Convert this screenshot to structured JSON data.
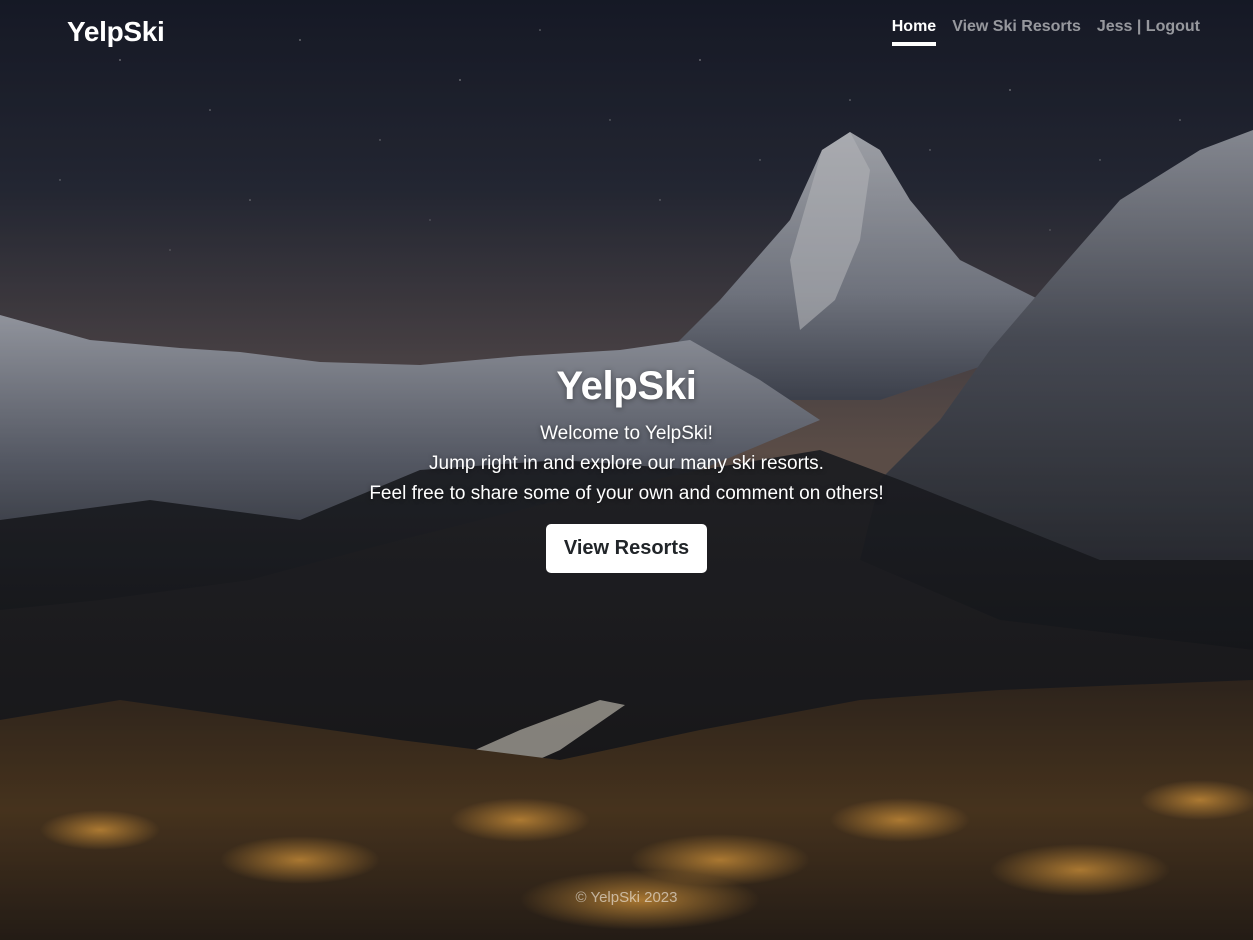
{
  "nav": {
    "brand": "YelpSki",
    "links": [
      {
        "label": "Home",
        "active": true
      },
      {
        "label": "View Ski Resorts",
        "active": false
      },
      {
        "label": "Jess | Logout",
        "active": false
      }
    ]
  },
  "hero": {
    "title": "YelpSki",
    "lines": [
      "Welcome to YelpSki!",
      "Jump right in and explore our many ski resorts.",
      "Feel free to share some of your own and comment on others!"
    ],
    "button_label": "View Resorts",
    "background": "night-mountain-village-photo"
  },
  "footer": {
    "text": "© YelpSki 2023"
  },
  "colors": {
    "button_bg": "#ffffff",
    "button_text": "#212529",
    "nav_inactive": "rgba(255,255,255,0.55)",
    "sky_top": "#1c2030",
    "sky_horizon": "#6e6058"
  }
}
